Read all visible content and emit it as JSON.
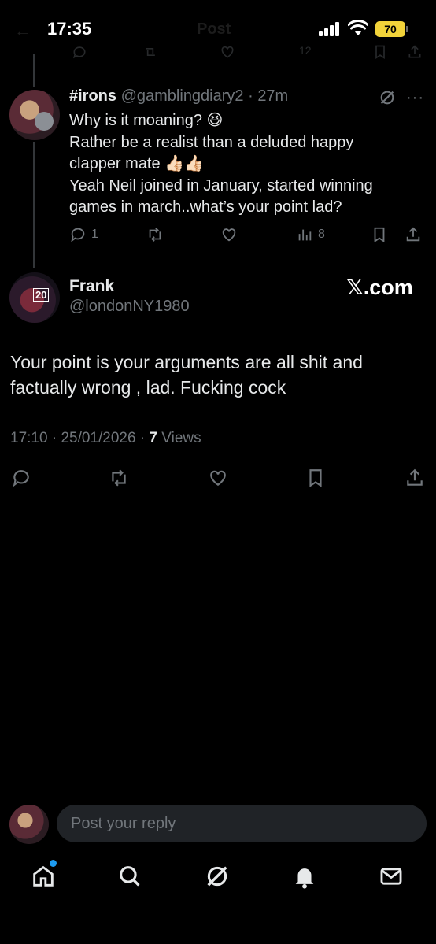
{
  "status_bar": {
    "time": "17:35",
    "battery": "70",
    "header_title": "Post"
  },
  "previous_tweet": {
    "views": "12"
  },
  "reply_tweet": {
    "name": "#irons",
    "handle": "@gamblingdiary2",
    "time": "27m",
    "lines": [
      "Why is it moaning? 😆",
      "Rather be a realist than a deluded happy",
      "clapper mate 👍🏻👍🏻",
      "Yeah Neil joined in January, started winning",
      "games in march..what’s your point lad?"
    ],
    "reply_count": "1",
    "views": "8"
  },
  "main_tweet": {
    "name": "Frank",
    "handle": "@londonNY1980",
    "brand": "𝕏.com",
    "jersey_number": "20",
    "text": "Your point is your arguments are all shit and factually wrong , lad. Fucking cock",
    "time": "17:10",
    "date": "25/01/2026",
    "views_count": "7",
    "views_label": "Views"
  },
  "composer": {
    "placeholder": "Post your reply"
  },
  "colors": {
    "background": "#000000",
    "text": "#e7e9ea",
    "muted": "#71767b",
    "accent": "#1d9bf0",
    "battery": "#f2d33a"
  },
  "icons": [
    "reply-icon",
    "retweet-icon",
    "like-icon",
    "views-icon",
    "bookmark-icon",
    "share-icon",
    "grok-icon",
    "home-icon",
    "search-icon",
    "bell-icon",
    "mail-icon"
  ]
}
